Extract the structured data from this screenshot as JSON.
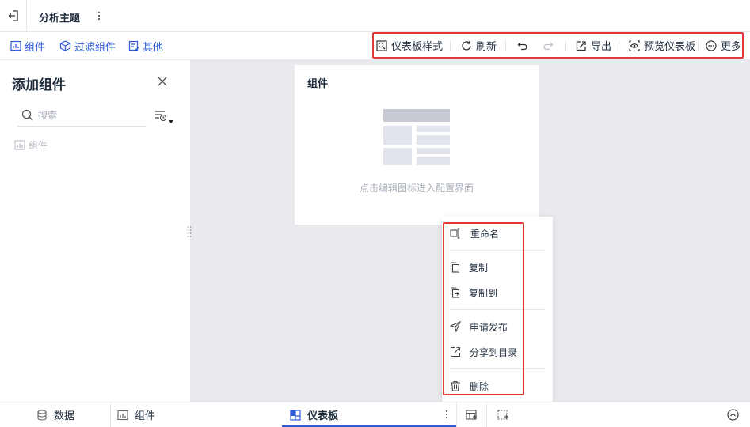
{
  "app": {
    "title": "分析主题"
  },
  "toolbar_left": [
    {
      "label": "组件",
      "icon": "chart-widget-icon"
    },
    {
      "label": "过滤组件",
      "icon": "cube-filter-icon"
    },
    {
      "label": "其他",
      "icon": "doc-edit-icon"
    }
  ],
  "toolbar_right": {
    "dashboard_style": "仪表板样式",
    "refresh": "刷新",
    "export": "导出",
    "preview": "预览仪表板",
    "more": "更多"
  },
  "panel": {
    "title": "添加组件",
    "search_placeholder": "搜索",
    "tree_item": "组件"
  },
  "card": {
    "title": "组件",
    "hint": "点击编辑图标进入配置界面"
  },
  "context_menu": {
    "rename": "重命名",
    "copy": "复制",
    "copy_to": "复制到",
    "apply_publish": "申请发布",
    "share_to_dir": "分享到目录",
    "delete": "删除"
  },
  "bottom_tabs": {
    "data": "数据",
    "widget": "组件",
    "dashboard": "仪表板"
  },
  "colors": {
    "accent": "#2d5bd7",
    "highlight": "#e03a3a",
    "canvas_bg": "#e9eaee"
  }
}
